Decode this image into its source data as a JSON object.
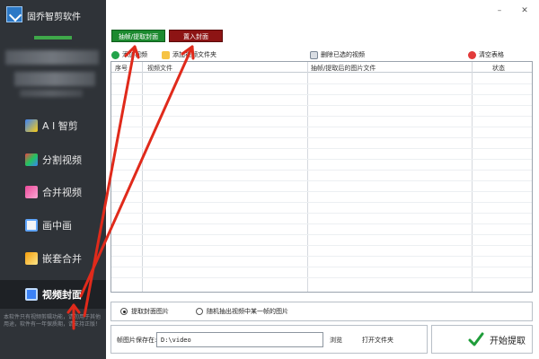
{
  "app": {
    "title": "固乔智剪软件"
  },
  "sidebar": {
    "items": [
      {
        "label": "A I 智剪",
        "icon": "ai-edit-icon"
      },
      {
        "label": "分割视频",
        "icon": "split-video-icon"
      },
      {
        "label": "合并视频",
        "icon": "merge-video-icon"
      },
      {
        "label": "画中画",
        "icon": "picture-in-picture-icon"
      },
      {
        "label": "嵌套合并",
        "icon": "nest-merge-icon"
      },
      {
        "label": "视频封面",
        "icon": "video-cover-icon",
        "active": true
      }
    ],
    "note": "本软件只有视频剪辑功能，请勿用于其他用途，软件有一年保质期，请支持正版！"
  },
  "tabs": {
    "extract": "抽帧/提取封面",
    "import": "置入封面"
  },
  "toolbar": {
    "add_video": "添加视频",
    "add_folder": "添加视频文件夹",
    "delete_selected": "删除已选的视频",
    "clear_table": "清空表格"
  },
  "table": {
    "headers": {
      "index": "序号",
      "video": "视频文件",
      "image": "抽帧/提取后的图片文件",
      "status": "状态"
    }
  },
  "options": {
    "extract_cover": "提取封面图片",
    "random_frame": "随机抽出视频中某一帧的图片"
  },
  "save": {
    "label": "帧图片保存在:",
    "path": "D:\\video",
    "browse": "浏览",
    "open_folder": "打开文件夹"
  },
  "start": {
    "label": "开始提取"
  },
  "colors": {
    "sidebar": "#2f3338",
    "extract_btn": "#1c8a2f",
    "import_btn": "#8d1414",
    "arrow": "#e02a1b"
  }
}
